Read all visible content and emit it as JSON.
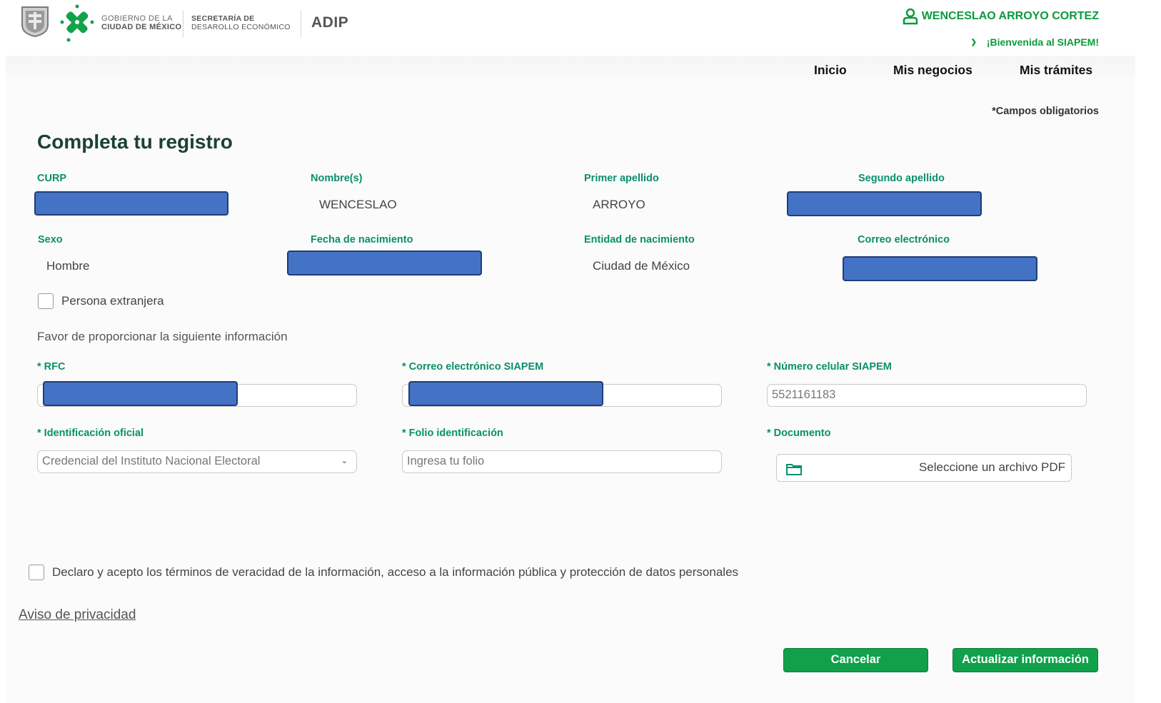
{
  "header": {
    "gob_line1": "GOBIERNO DE LA",
    "gob_line2": "CIUDAD DE MÉXICO",
    "sec_line1": "SECRETARÍA DE",
    "sec_line2": "DESAROLLO ECONÓMICO",
    "agency": "ADIP",
    "user_name": "WENCESLAO ARROYO CORTEZ",
    "welcome": "¡Bienvenida al SIAPEM!",
    "brand_color": "#0a9a3c"
  },
  "nav": {
    "items": [
      "Inicio",
      "Mis negocios",
      "Mis trámites"
    ]
  },
  "form": {
    "required_note": "*Campos obligatorios",
    "title": "Completa tu registro",
    "labels": {
      "curp": "CURP",
      "nombres": "Nombre(s)",
      "primer_apellido": "Primer apellido",
      "segundo_apellido": "Segundo apellido",
      "sexo": "Sexo",
      "fecha_nacimiento": "Fecha de nacimiento",
      "entidad_nacimiento": "Entidad de nacimiento",
      "correo": "Correo electrónico"
    },
    "values": {
      "nombres": "WENCESLAO",
      "primer_apellido": "ARROYO",
      "sexo": "Hombre",
      "entidad_nacimiento": "Ciudad de México"
    },
    "extranjera_label": "Persona extranjera",
    "instructions": "Favor de proporcionar la siguiente información",
    "rfc_label": "* RFC",
    "correo_siapem_label": "* Correo electrónico SIAPEM",
    "celular_label": "* Número celular SIAPEM",
    "celular_value": "5521161183",
    "identificacion_label": "* Identificación oficial",
    "identificacion_value": "Credencial del Instituto Nacional Electoral",
    "folio_label": "* Folio identificación",
    "folio_placeholder": "Ingresa tu folio",
    "documento_label": "* Documento",
    "documento_text": "Seleccione un archivo PDF",
    "terms_label": "Declaro y acepto los términos de veracidad de la información, acceso a la información pública y protección de datos personales",
    "privacy_link": "Aviso de privacidad",
    "cancel_button": "Cancelar",
    "update_button": "Actualizar información",
    "label_color": "#0b8f6b",
    "button_color": "#10a14a",
    "redaction_color": "#4473c5"
  }
}
